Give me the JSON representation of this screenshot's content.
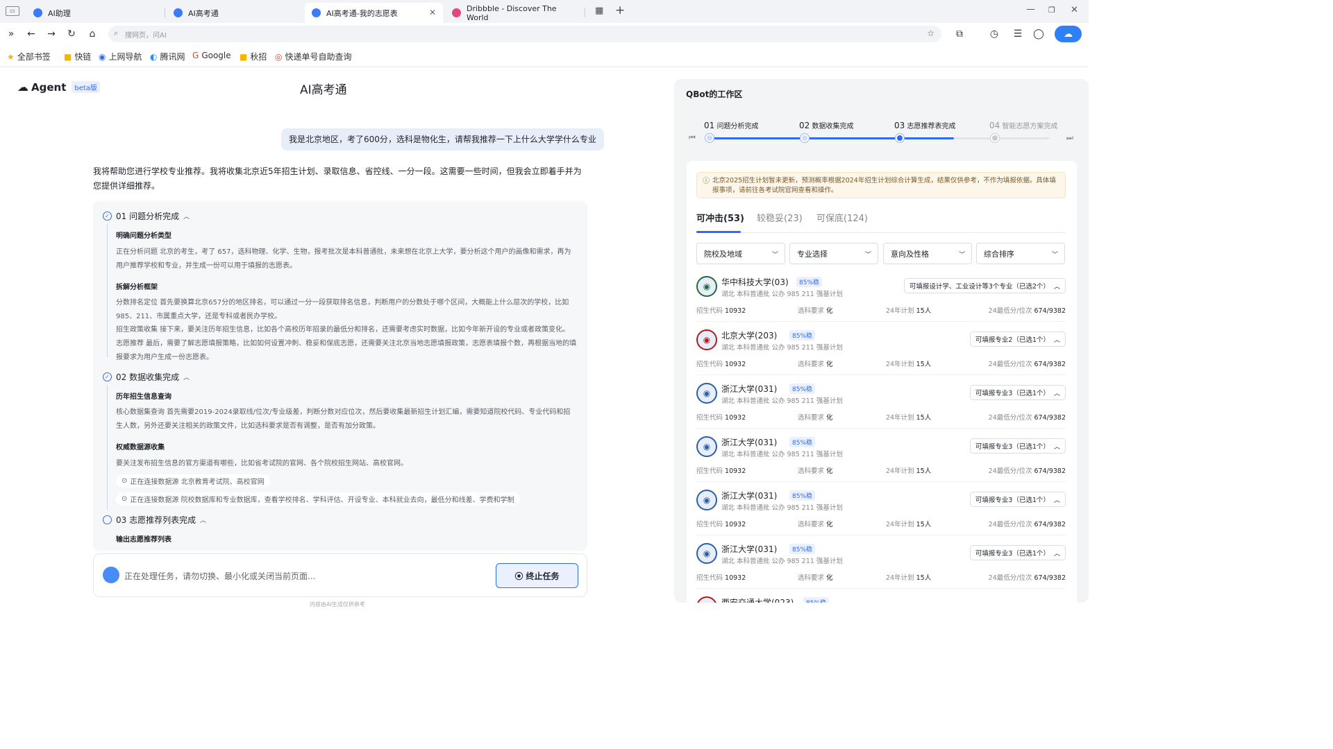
{
  "browser": {
    "tabs": [
      {
        "title": "AI助理",
        "color": "#3b7bf5"
      },
      {
        "title": "AI高考通",
        "color": "#3b7bf5"
      },
      {
        "title": "AI高考通-我的志愿表",
        "color": "#3b7bf5"
      },
      {
        "title": "Dribbble - Discover The World",
        "color": "#e3457f"
      }
    ],
    "address_placeholder": "搜网页，问AI",
    "bookmarks": [
      "全部书签",
      "快链",
      "上网导航",
      "腾讯网",
      "Google",
      "秋招",
      "快递单号自助查询"
    ]
  },
  "agent": {
    "logo": "Agent",
    "beta": "beta版",
    "page_title": "AI高考通",
    "user_message": "我是北京地区，考了600分，选科是物化生，请帮我推荐一下上什么大学学什么专业",
    "intro": "我将帮助您进行学校专业推荐。我将收集北京近5年招生计划、录取信息、省控线、一分一段。这需要一些时间，但我会立即着手并为您提供详细推荐。",
    "steps": [
      {
        "title": "01 问题分析完成",
        "sections": [
          {
            "heading": "明确问题分析类型",
            "paras": [
              "正在分析问题 北京的考生，考了 657，选科物理、化学、生物，报考批次是本科普通批，未来想在北京上大学，要分析这个用户的画像和需求，再为用户推荐学校和专业，并生成一份可以用于填报的志愿表。"
            ]
          },
          {
            "heading": "拆解分析框架",
            "paras": [
              "分数排名定位 首先要换算北京657分的地区排名，可以通过一分一段获取排名信息，判断用户的分数处于哪个区间，大概能上什么层次的学校，比如985、211、市属重点大学，还是专科或者民办学校。",
              "招生政策收集 接下来，要关注历年招生信息，比如各个高校历年招录的最低分和排名，还需要考虑实时数据，比如今年新开设的专业或者政策变化。",
              "志愿推荐 最后，需要了解志愿填报策略，比如如何设置冲刺、稳妥和保底志愿，还需要关注北京当地志愿填报政策，志愿表填报个数，再根据当地的填报要求为用户生成一份志愿表。"
            ]
          }
        ]
      },
      {
        "title": "02  数据收集完成",
        "sections": [
          {
            "heading": "历年招生信息查询",
            "paras": [
              "核心数据集查询 首先需要2019-2024录取线/位次/专业级差，判断分数对应位次，然后要收集最新招生计划汇编，需要知道院校代码、专业代码和招生人数，另外还要关注相关的政策文件，比如选科要求是否有调整，是否有加分政策。"
            ]
          },
          {
            "heading": "权威数据源收集",
            "paras": [
              "要关注发布招生信息的官方渠道有哪些，比如省考试院的官网、各个院校招生网站、高校官网。"
            ]
          }
        ],
        "sources": [
          "正在连接数据源 北京教育考试院、高校官网",
          "正在连接数据源 院校数据库和专业数据库，查看学校排名、学科评估、开设专业、本科就业去向，最低分和线差、学费和学制"
        ]
      },
      {
        "title": "03  志愿推荐列表完成",
        "sections": [
          {
            "heading": "输出志愿推荐列表",
            "paras": []
          }
        ]
      }
    ],
    "input_placeholder": "正在处理任务，请勿切换、最小化或关闭当前页面...",
    "stop_label": "终止任务",
    "disclaimer": "内容由AI生成仅供参考"
  },
  "workspace": {
    "title": "QBot的工作区",
    "progress": [
      {
        "num": "01",
        "label": "问题分析完成",
        "done": true
      },
      {
        "num": "02",
        "label": "数据收集完成",
        "done": true
      },
      {
        "num": "03",
        "label": "志愿推荐表完成",
        "done": true
      },
      {
        "num": "04",
        "label": "智能志愿方案完成",
        "done": false
      }
    ],
    "progress_fraction": 0.72,
    "notice": "北京2025招生计划暂未更新，预测概率根据2024年招生计划综合计算生成，结果仅供参考，不作为填报依据。具体填报事项，请前往各考试院官网查看和操作。",
    "tabs": [
      "可冲击(53)",
      "较稳妥(23)",
      "可保底(124)"
    ],
    "filters": [
      "院校及地域",
      "专业选择",
      "意向及性格",
      "综合排序"
    ],
    "labels": {
      "code": "招生代码",
      "req": "选科要求",
      "plan": "24年计划",
      "score": "24最低分/位次"
    },
    "schools": [
      {
        "name": "华中科技大学(03)",
        "prob": "85%稳",
        "meta": "湖北 本科普通批 公办 985 211 强基计划",
        "pick": "可填报设计学、工业设计等3个专业（已选2个）",
        "code": "10932",
        "req": "化",
        "plan": "15人",
        "score": "674/9382",
        "logo_color": "#1f6b3a"
      },
      {
        "name": "北京大学(203)",
        "prob": "85%稳",
        "meta": "湖北 本科普通批 公办 985 211 强基计划",
        "pick": "可填报专业2（已选1个）",
        "code": "10932",
        "req": "化",
        "plan": "15人",
        "score": "674/9382",
        "logo_color": "#b31b1b"
      },
      {
        "name": "浙江大学(031)",
        "prob": "85%稳",
        "meta": "湖北 本科普通批 公办 985 211 强基计划",
        "pick": "可填报专业3（已选1个）",
        "code": "10932",
        "req": "化",
        "plan": "15人",
        "score": "674/9382",
        "logo_color": "#2a5ea8"
      },
      {
        "name": "浙江大学(031)",
        "prob": "85%稳",
        "meta": "湖北 本科普通批 公办 985 211 强基计划",
        "pick": "可填报专业3（已选1个）",
        "code": "10932",
        "req": "化",
        "plan": "15人",
        "score": "674/9382",
        "logo_color": "#2a5ea8"
      },
      {
        "name": "浙江大学(031)",
        "prob": "85%稳",
        "meta": "湖北 本科普通批 公办 985 211 强基计划",
        "pick": "可填报专业3（已选1个）",
        "code": "10932",
        "req": "化",
        "plan": "15人",
        "score": "674/9382",
        "logo_color": "#2a5ea8"
      },
      {
        "name": "浙江大学(031)",
        "prob": "85%稳",
        "meta": "湖北 本科普通批 公办 985 211 强基计划",
        "pick": "可填报专业3（已选1个）",
        "code": "10932",
        "req": "化",
        "plan": "15人",
        "score": "674/9382",
        "logo_color": "#2a5ea8"
      },
      {
        "name": "西安交通大学(023)",
        "prob": "85%稳",
        "meta": "",
        "pick": "",
        "code": "",
        "req": "",
        "plan": "",
        "score": "",
        "logo_color": "#b31b1b"
      }
    ]
  }
}
